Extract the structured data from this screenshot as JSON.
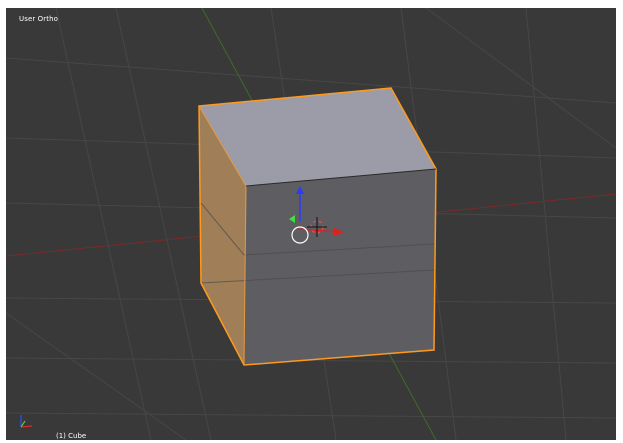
{
  "viewport": {
    "view_label": "User Ortho",
    "object_label": "(1) Cube",
    "background_color": "#393939",
    "grid_color": "#474747",
    "x_axis_color": "#7a2a2a",
    "y_axis_color": "#3f6a2a",
    "selection_outline_color": "#ff9a1c"
  },
  "scene": {
    "object_name": "Cube",
    "object_type": "mesh",
    "selected": true,
    "cube_faces": {
      "top_color": "#9c9ca8",
      "front_color": "#5d5d62",
      "left_color": "#a07f58"
    },
    "widgets": {
      "manipulator": [
        "x-arrow-red",
        "y-arrow-green",
        "z-arrow-blue"
      ],
      "cursor": "3d-cursor",
      "mini_axes": "orientation-gizmo"
    }
  }
}
